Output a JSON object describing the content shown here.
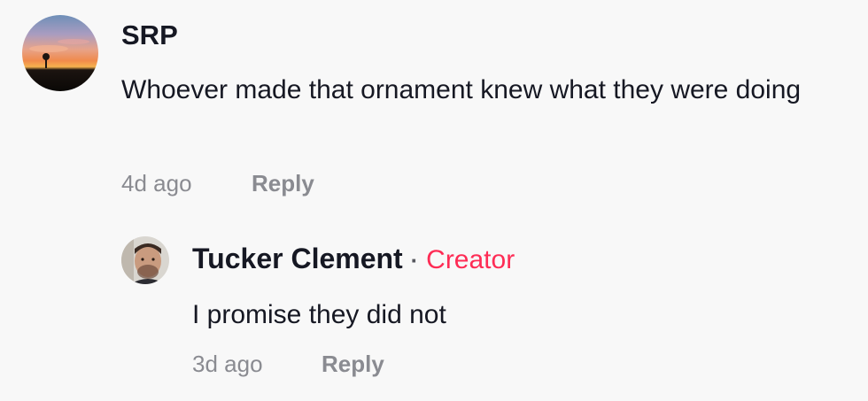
{
  "comments": [
    {
      "username": "SRP",
      "text": "Whoever made that ornament knew what they were doing",
      "timestamp": "4d ago",
      "reply_label": "Reply",
      "avatar_icon": "sunset-photo-avatar"
    }
  ],
  "replies": [
    {
      "username": "Tucker Clement",
      "separator": "·",
      "badge": "Creator",
      "text": "I promise they did not",
      "timestamp": "3d ago",
      "reply_label": "Reply",
      "avatar_icon": "profile-photo-avatar"
    }
  ],
  "colors": {
    "background": "#f8f8f8",
    "primary_text": "#161823",
    "secondary_text": "#8a8b91",
    "creator_badge": "#fe2c55"
  }
}
